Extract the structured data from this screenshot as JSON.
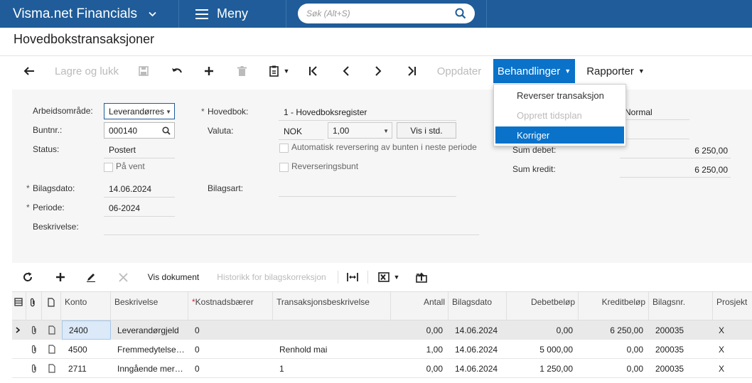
{
  "topbar": {
    "app_title": "Visma.net Financials",
    "menu_label": "Meny",
    "search_placeholder": "Søk (Alt+S)"
  },
  "page_title": "Hovedbokstransaksjoner",
  "toolbar": {
    "save_close": "Lagre og lukk",
    "update": "Oppdater",
    "actions": "Behandlinger",
    "reports": "Rapporter"
  },
  "actions_menu": [
    {
      "label": "Reverser transaksjon",
      "state": "enabled"
    },
    {
      "label": "Opprett tidsplan",
      "state": "disabled"
    },
    {
      "label": "Korriger",
      "state": "selected"
    }
  ],
  "form": {
    "area_label": "Arbeidsområde:",
    "area_value": "Leverandørreskontro",
    "batch_label": "Buntnr.:",
    "batch_value": "000140",
    "status_label": "Status:",
    "status_value": "Postert",
    "on_hold_label": "På vent",
    "doc_date_label": "Bilagsdato:",
    "doc_date_value": "14.06.2024",
    "period_label": "Periode:",
    "period_value": "06-2024",
    "description_label": "Beskrivelse:",
    "ledger_label": "Hovedbok:",
    "ledger_value": "1 - Hovedboksregister",
    "currency_label": "Valuta:",
    "currency_value": "NOK",
    "rate_value": "1,00",
    "vis_std": "Vis i std.",
    "auto_reverse_label": "Automatisk reversering av bunten i neste periode",
    "reversing_label": "Reverseringsbunt",
    "doc_type_label": "Bilagsart:",
    "type_value": "Normal",
    "sum_debit_label": "Sum debet:",
    "sum_debit_value": "6 250,00",
    "sum_credit_label": "Sum kredit:",
    "sum_credit_value": "6 250,00"
  },
  "grid_toolbar": {
    "show_doc": "Vis dokument",
    "history": "Historikk for bilagskorreksjon"
  },
  "grid": {
    "headers": {
      "account": "Konto",
      "description": "Beskrivelse",
      "cost_center": "Kostnadsbærer",
      "trans_desc": "Transaksjonsbeskrivelse",
      "qty": "Antall",
      "doc_date": "Bilagsdato",
      "debit": "Debetbeløp",
      "credit": "Kreditbeløp",
      "doc_no": "Bilagsnr.",
      "project": "Prosjekt"
    },
    "rows": [
      {
        "account": "2400",
        "description": "Leverandørgjeld",
        "cost_center": "0",
        "trans_desc": "",
        "qty": "0,00",
        "doc_date": "14.06.2024",
        "debit": "0,00",
        "credit": "6 250,00",
        "doc_no": "200035",
        "project": "X"
      },
      {
        "account": "4500",
        "description": "Fremmedytelse og underentreprise",
        "cost_center": "0",
        "trans_desc": "Renhold mai",
        "qty": "1,00",
        "doc_date": "14.06.2024",
        "debit": "5 000,00",
        "credit": "0,00",
        "doc_no": "200035",
        "project": "X"
      },
      {
        "account": "2711",
        "description": "Inngående merverdiavgift",
        "cost_center": "0",
        "trans_desc": "1",
        "qty": "0,00",
        "doc_date": "14.06.2024",
        "debit": "1 250,00",
        "credit": "0,00",
        "doc_no": "200035",
        "project": "X"
      }
    ]
  },
  "colors": {
    "topbar": "#1f5c99",
    "accent": "#0a72c9"
  }
}
